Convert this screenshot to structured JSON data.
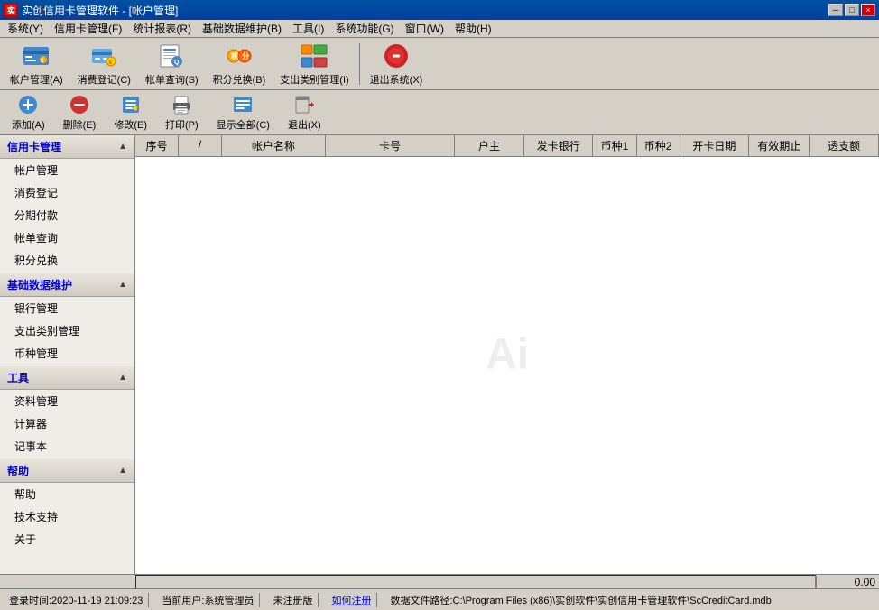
{
  "titlebar": {
    "app_icon": "C",
    "title": "实创信用卡管理软件 - [帐户管理]",
    "btn_minimize": "─",
    "btn_restore": "□",
    "btn_close": "×"
  },
  "menubar": {
    "items": [
      {
        "label": "系统(Y)",
        "id": "menu-system"
      },
      {
        "label": "信用卡管理(F)",
        "id": "menu-card"
      },
      {
        "label": "统计报表(R)",
        "id": "menu-report"
      },
      {
        "label": "基础数据维护(B)",
        "id": "menu-data"
      },
      {
        "label": "工具(I)",
        "id": "menu-tools"
      },
      {
        "label": "系统功能(G)",
        "id": "menu-func"
      },
      {
        "label": "窗口(W)",
        "id": "menu-window"
      },
      {
        "label": "帮助(H)",
        "id": "menu-help"
      }
    ]
  },
  "toolbar1": {
    "buttons": [
      {
        "label": "帐户管理(A)",
        "id": "tb1-account"
      },
      {
        "label": "消费登记(C)",
        "id": "tb1-consume"
      },
      {
        "label": "帐单查询(S)",
        "id": "tb1-bill"
      },
      {
        "label": "积分兑换(B)",
        "id": "tb1-points"
      },
      {
        "label": "支出类别管理(I)",
        "id": "tb1-category"
      },
      {
        "label": "退出系统(X)",
        "id": "tb1-exit"
      }
    ]
  },
  "toolbar2": {
    "buttons": [
      {
        "label": "添加(A)",
        "id": "tb2-add"
      },
      {
        "label": "删除(E)",
        "id": "tb2-delete"
      },
      {
        "label": "修改(E)",
        "id": "tb2-edit"
      },
      {
        "label": "打印(P)",
        "id": "tb2-print"
      },
      {
        "label": "显示全部(C)",
        "id": "tb2-showall"
      },
      {
        "label": "退出(X)",
        "id": "tb2-exit"
      }
    ]
  },
  "sidebar": {
    "sections": [
      {
        "title": "信用卡管理",
        "id": "section-card",
        "items": [
          {
            "label": "帐户管理",
            "id": "nav-account"
          },
          {
            "label": "消费登记",
            "id": "nav-consume"
          },
          {
            "label": "分期付款",
            "id": "nav-installment"
          },
          {
            "label": "帐单查询",
            "id": "nav-bill"
          },
          {
            "label": "积分兑换",
            "id": "nav-points"
          }
        ]
      },
      {
        "title": "基础数据维护",
        "id": "section-base",
        "items": [
          {
            "label": "银行管理",
            "id": "nav-bank"
          },
          {
            "label": "支出类别管理",
            "id": "nav-category"
          },
          {
            "label": "币种管理",
            "id": "nav-currency"
          }
        ]
      },
      {
        "title": "工具",
        "id": "section-tools",
        "items": [
          {
            "label": "资料管理",
            "id": "nav-data"
          },
          {
            "label": "计算器",
            "id": "nav-calc"
          },
          {
            "label": "记事本",
            "id": "nav-notes"
          }
        ]
      },
      {
        "title": "帮助",
        "id": "section-help",
        "items": [
          {
            "label": "帮助",
            "id": "nav-help"
          },
          {
            "label": "技术支持",
            "id": "nav-support"
          },
          {
            "label": "关于",
            "id": "nav-about"
          }
        ]
      }
    ]
  },
  "table": {
    "columns": [
      {
        "label": "序号",
        "class": "seq"
      },
      {
        "label": "/",
        "class": "seq"
      },
      {
        "label": "帐户名称",
        "class": "name"
      },
      {
        "label": "卡号",
        "class": "card"
      },
      {
        "label": "户主",
        "class": "owner"
      },
      {
        "label": "发卡银行",
        "class": "bank"
      },
      {
        "label": "币种1",
        "class": "cur1"
      },
      {
        "label": "币种2",
        "class": "cur2"
      },
      {
        "label": "开卡日期",
        "class": "opendate"
      },
      {
        "label": "有效期止",
        "class": "expiry"
      },
      {
        "label": "透支额",
        "class": "credit"
      }
    ],
    "rows": [],
    "watermark": "Ai"
  },
  "statusbar": {
    "login_time": "登录时间:2020-11-19 21:09:23",
    "current_user": "当前用户:系统管理员",
    "version": "未注册版",
    "register_link": "如何注册",
    "db_path": "数据文件路径:C:\\Program Files (x86)\\实创软件\\实创信用卡管理软件\\ScCreditCard.mdb"
  },
  "amount_bar": {
    "value": "0.00"
  }
}
